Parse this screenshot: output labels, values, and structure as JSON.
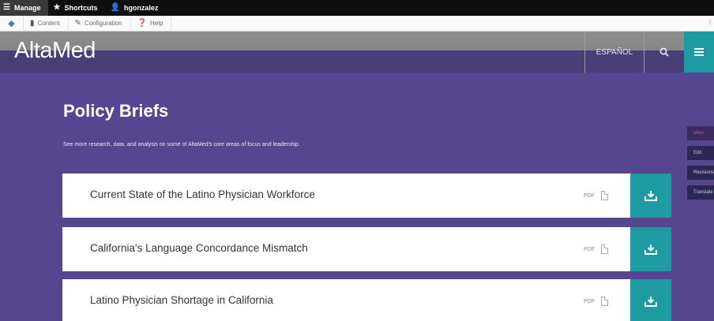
{
  "admin_toolbar": {
    "items": [
      {
        "label": "Manage",
        "icon": "menu-icon"
      },
      {
        "label": "Shortcuts",
        "icon": "star-icon"
      },
      {
        "label": "hgonzalez",
        "icon": "user-icon"
      }
    ]
  },
  "tray": {
    "items": [
      {
        "label": "Content",
        "icon": "file-icon"
      },
      {
        "label": "Configuration",
        "icon": "wrench-icon"
      },
      {
        "label": "Help",
        "icon": "help-icon"
      }
    ]
  },
  "header": {
    "logo": "AltaMed",
    "language_link": "ESPAÑOL",
    "colors": {
      "band": "#4a3e78",
      "accent": "#1e9aa2"
    }
  },
  "main": {
    "title": "Policy Briefs",
    "description": "See more research, data, and analysis on some of AltaMed's core areas of focus and leadership.",
    "briefs": [
      {
        "title": "Current State of the Latino Physician Workforce",
        "format": "PDF"
      },
      {
        "title": "California's Language Concordance Mismatch",
        "format": "PDF"
      },
      {
        "title": "Latino Physician Shortage in California",
        "format": "PDF"
      }
    ]
  },
  "side_tabs": [
    {
      "label": "View"
    },
    {
      "label": "Edit"
    },
    {
      "label": "Revisions"
    },
    {
      "label": "Translate"
    }
  ],
  "colors": {
    "background": "#56468f",
    "teal": "#1e9aa2"
  }
}
